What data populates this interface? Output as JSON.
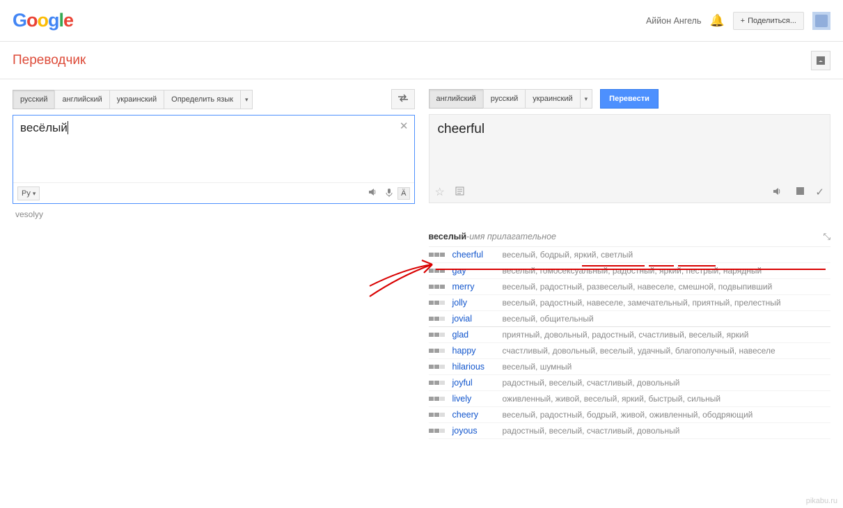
{
  "header": {
    "logo_text": "Google",
    "user_name": "Аййон Ангель",
    "share_label": "Поделиться..."
  },
  "toolbar": {
    "app_title": "Переводчик"
  },
  "source": {
    "langs": [
      "русский",
      "английский",
      "украинский",
      "Определить язык"
    ],
    "active_index": 0,
    "input_text": "весёлый",
    "input_method": "Ру",
    "keyboard_label": "Ä",
    "transliteration": "vesolyy"
  },
  "target": {
    "langs": [
      "английский",
      "русский",
      "украинский"
    ],
    "active_index": 0,
    "translate_label": "Перевести",
    "output_text": "cheerful"
  },
  "dict": {
    "word": "веселый",
    "sep": " - ",
    "pos": "имя прилагательное",
    "groups": [
      [
        {
          "freq": 3,
          "term": "cheerful",
          "syns": "веселый, бодрый, яркий, светлый"
        },
        {
          "freq": 3,
          "term": "gay",
          "syns": "веселый, гомосексуальный, радостный, яркий, пестрый, нарядный"
        },
        {
          "freq": 3,
          "term": "merry",
          "syns": "веселый, радостный, развеселый, навеселе, смешной, подвыпивший"
        },
        {
          "freq": 2,
          "term": "jolly",
          "syns": "веселый, радостный, навеселе, замечательный, приятный, прелестный"
        },
        {
          "freq": 2,
          "term": "jovial",
          "syns": "веселый, общительный"
        }
      ],
      [
        {
          "freq": 2,
          "term": "glad",
          "syns": "приятный, довольный, радостный, счастливый, веселый, яркий"
        },
        {
          "freq": 2,
          "term": "happy",
          "syns": "счастливый, довольный, веселый, удачный, благополучный, навеселе"
        },
        {
          "freq": 2,
          "term": "hilarious",
          "syns": "веселый, шумный"
        },
        {
          "freq": 2,
          "term": "joyful",
          "syns": "радостный, веселый, счастливый, довольный"
        },
        {
          "freq": 2,
          "term": "lively",
          "syns": "оживленный, живой, веселый, яркий, быстрый, сильный"
        },
        {
          "freq": 2,
          "term": "cheery",
          "syns": "веселый, радостный, бодрый, живой, оживленный, ободряющий"
        },
        {
          "freq": 2,
          "term": "joyous",
          "syns": "радостный, веселый, счастливый, довольный"
        }
      ]
    ]
  },
  "watermark": "pikabu.ru"
}
